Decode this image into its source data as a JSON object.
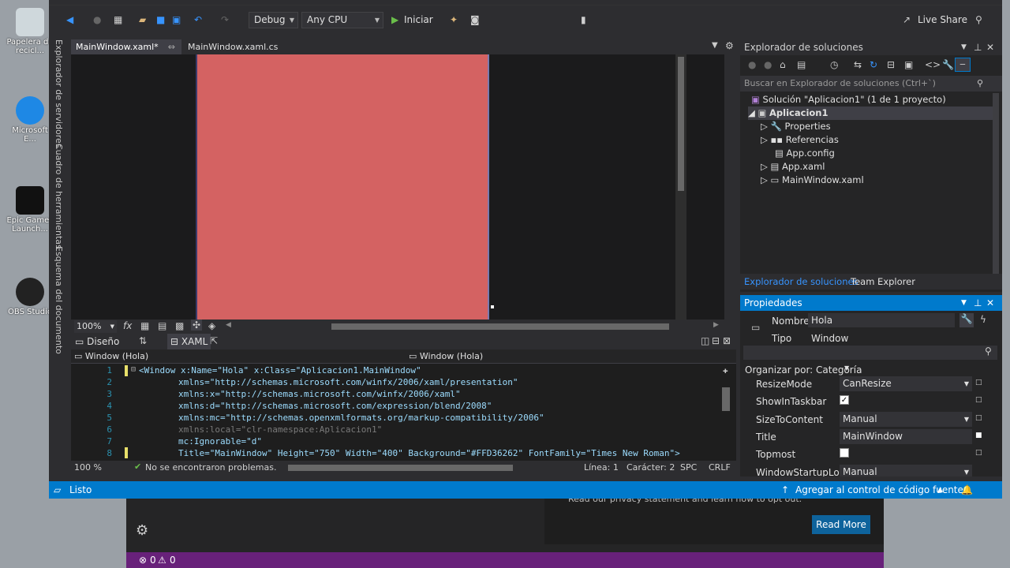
{
  "desktop": {
    "icons": [
      {
        "label": "Papelera de recicl..."
      },
      {
        "label": "Microsoft E..."
      },
      {
        "label": "Epic Games Launch..."
      },
      {
        "label": "OBS Studio"
      }
    ]
  },
  "toolbar": {
    "config": "Debug",
    "platform": "Any CPU",
    "start_label": "Iniciar",
    "live_share": "Live Share"
  },
  "side_strip": [
    "Explorador de servidores",
    "Cuadro de herramientas",
    "Esquema del documento"
  ],
  "doc_tabs": [
    {
      "label": "MainWindow.xaml*"
    },
    {
      "label": "MainWindow.xaml.cs"
    }
  ],
  "designer": {
    "zoom": "100%",
    "artboard_color": "#D46262"
  },
  "split_tabs": {
    "design": "Diseño",
    "xaml": "XAML"
  },
  "xaml_header": {
    "left": "Window (Hola)",
    "right": "Window (Hola)"
  },
  "code": {
    "lines": [
      {
        "n": "1",
        "text": "<Window x:Name=\"Hola\" x:Class=\"Aplicacion1.MainWindow\""
      },
      {
        "n": "2",
        "text": "xmlns=\"http://schemas.microsoft.com/winfx/2006/xaml/presentation\""
      },
      {
        "n": "3",
        "text": "xmlns:x=\"http://schemas.microsoft.com/winfx/2006/xaml\""
      },
      {
        "n": "4",
        "text": "xmlns:d=\"http://schemas.microsoft.com/expression/blend/2008\""
      },
      {
        "n": "5",
        "text": "xmlns:mc=\"http://schemas.openxmlformats.org/markup-compatibility/2006\""
      },
      {
        "n": "6",
        "text": "xmlns:local=\"clr-namespace:Aplicacion1\""
      },
      {
        "n": "7",
        "text": "mc:Ignorable=\"d\""
      },
      {
        "n": "8",
        "text": "Title=\"MainWindow\" Height=\"750\" Width=\"400\" Background=\"#FFD36262\" FontFamily=\"Times New Roman\">"
      }
    ]
  },
  "code_bar": {
    "zoom": "100 %",
    "issues": "No se encontraron problemas.",
    "line": "Línea: 1",
    "char": "Carácter: 2",
    "spc": "SPC",
    "eol": "CRLF"
  },
  "solution": {
    "title": "Explorador de soluciones",
    "search_placeholder": "Buscar en Explorador de soluciones (Ctrl+`)",
    "items": [
      {
        "label": "Solución \"Aplicacion1\" (1 de 1 proyecto)"
      },
      {
        "label": "Aplicacion1"
      },
      {
        "label": "Properties"
      },
      {
        "label": "Referencias"
      },
      {
        "label": "App.config"
      },
      {
        "label": "App.xaml"
      },
      {
        "label": "MainWindow.xaml"
      }
    ],
    "tabs": [
      "Explorador de soluciones",
      "Team Explorer"
    ]
  },
  "properties": {
    "title": "Propiedades",
    "name_label": "Nombre",
    "name_value": "Hola",
    "type_label": "Tipo",
    "type_value": "Window",
    "arrange": "Organizar por: Categoría",
    "rows": [
      {
        "name": "ResizeMode",
        "value": "CanResize"
      },
      {
        "name": "ShowInTaskbar",
        "value": "✓"
      },
      {
        "name": "SizeToContent",
        "value": "Manual"
      },
      {
        "name": "Title",
        "value": "MainWindow"
      },
      {
        "name": "Topmost",
        "value": ""
      },
      {
        "name": "WindowStartupLo...",
        "value": "Manual"
      }
    ]
  },
  "statusbar": {
    "ready": "Listo",
    "source_control": "Agregar al control de código fuente"
  },
  "background_window": {
    "notice": "Read our privacy statement and learn how to opt out.",
    "read_more": "Read More",
    "errors": "0",
    "warnings": "0"
  }
}
